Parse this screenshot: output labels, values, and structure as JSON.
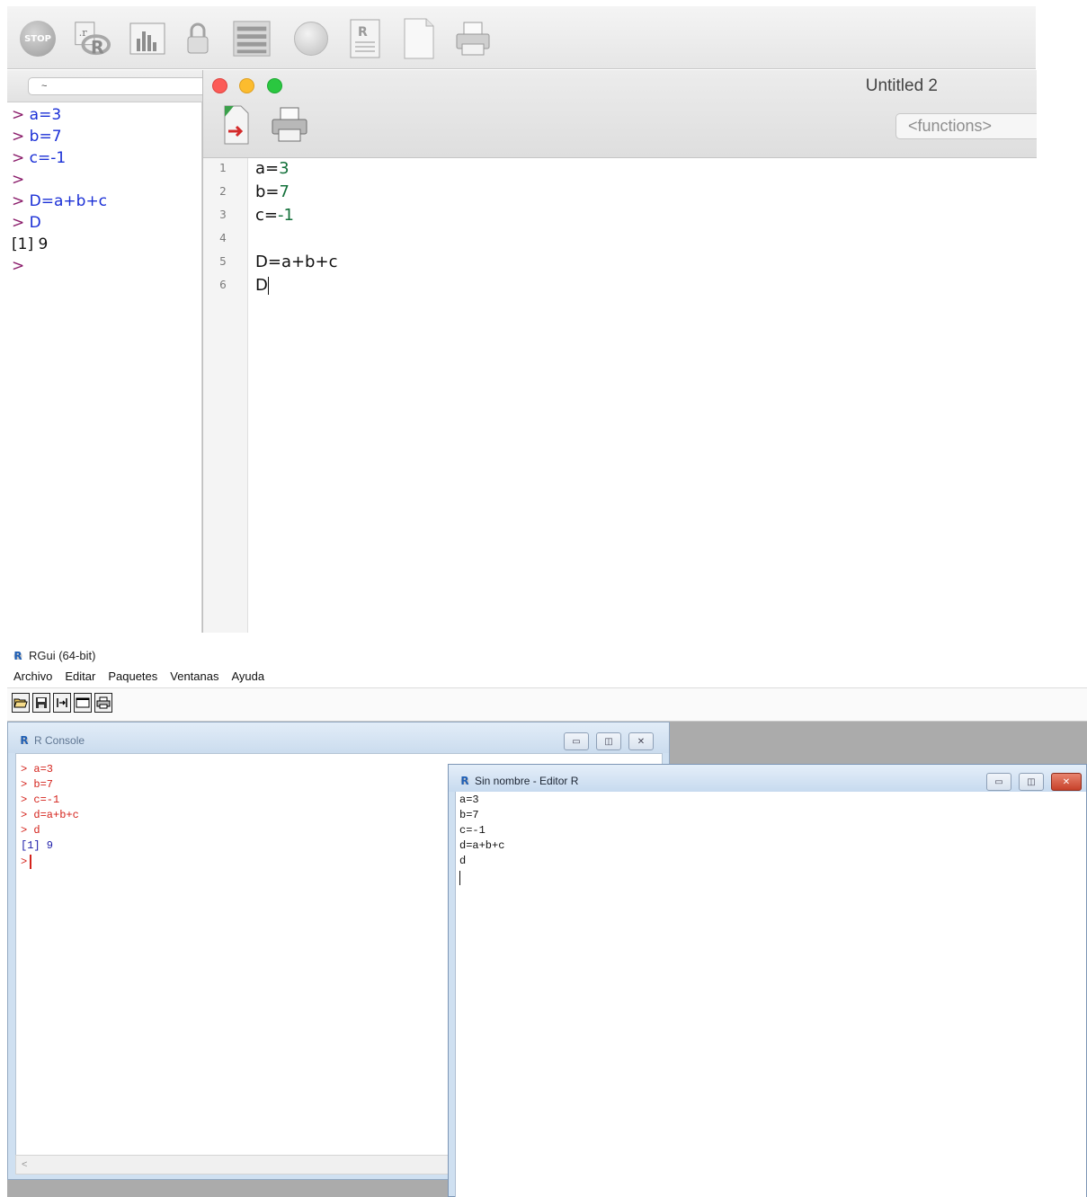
{
  "mac_app": {
    "toolbar_icons": [
      "stop-icon",
      "r-source-icon",
      "bar-chart-icon",
      "lock-icon",
      "list-icon",
      "gray-circle-icon",
      "r-document-icon",
      "blank-document-icon",
      "printer-icon"
    ],
    "toolbar_stop_label": "STOP",
    "console": {
      "working_directory": "~",
      "lines": [
        {
          "prompt": ">",
          "text": " a=3"
        },
        {
          "prompt": ">",
          "text": " b=7"
        },
        {
          "prompt": ">",
          "text": " c=-1"
        },
        {
          "prompt": ">",
          "text": ""
        },
        {
          "prompt": ">",
          "text": " D=a+b+c"
        },
        {
          "prompt": ">",
          "text": " D"
        }
      ],
      "output": "[1] 9",
      "last_prompt": ">"
    },
    "editor": {
      "title": "Untitled 2",
      "functions_placeholder": "<functions>",
      "line_numbers": [
        "1",
        "2",
        "3",
        "4",
        "5",
        "6"
      ],
      "code": {
        "l1_var": "a=",
        "l1_num": "3",
        "l2_var": "b=",
        "l2_num": "7",
        "l3_var": "c=",
        "l3_num": "-1",
        "l4": "",
        "l5": "D=a+b+c",
        "l6": "D"
      }
    }
  },
  "win_app": {
    "title": "RGui (64-bit)",
    "menu": [
      "Archivo",
      "Editar",
      "Paquetes",
      "Ventanas",
      "Ayuda"
    ],
    "toolbar_icons": [
      "open-folder-icon",
      "save-icon",
      "change-dir-icon",
      "console-window-icon",
      "print-icon"
    ],
    "console": {
      "title": "R Console",
      "lines": [
        "> a=3",
        "> b=7",
        "> c=-1",
        "> d=a+b+c",
        "> d"
      ],
      "output": "[1] 9",
      "last_prompt": ">",
      "scroll_left": "<"
    },
    "editor": {
      "title": "Sin nombre - Editor R",
      "lines": [
        "a=3",
        "b=7",
        "c=-1",
        "d=a+b+c",
        "d"
      ]
    }
  }
}
